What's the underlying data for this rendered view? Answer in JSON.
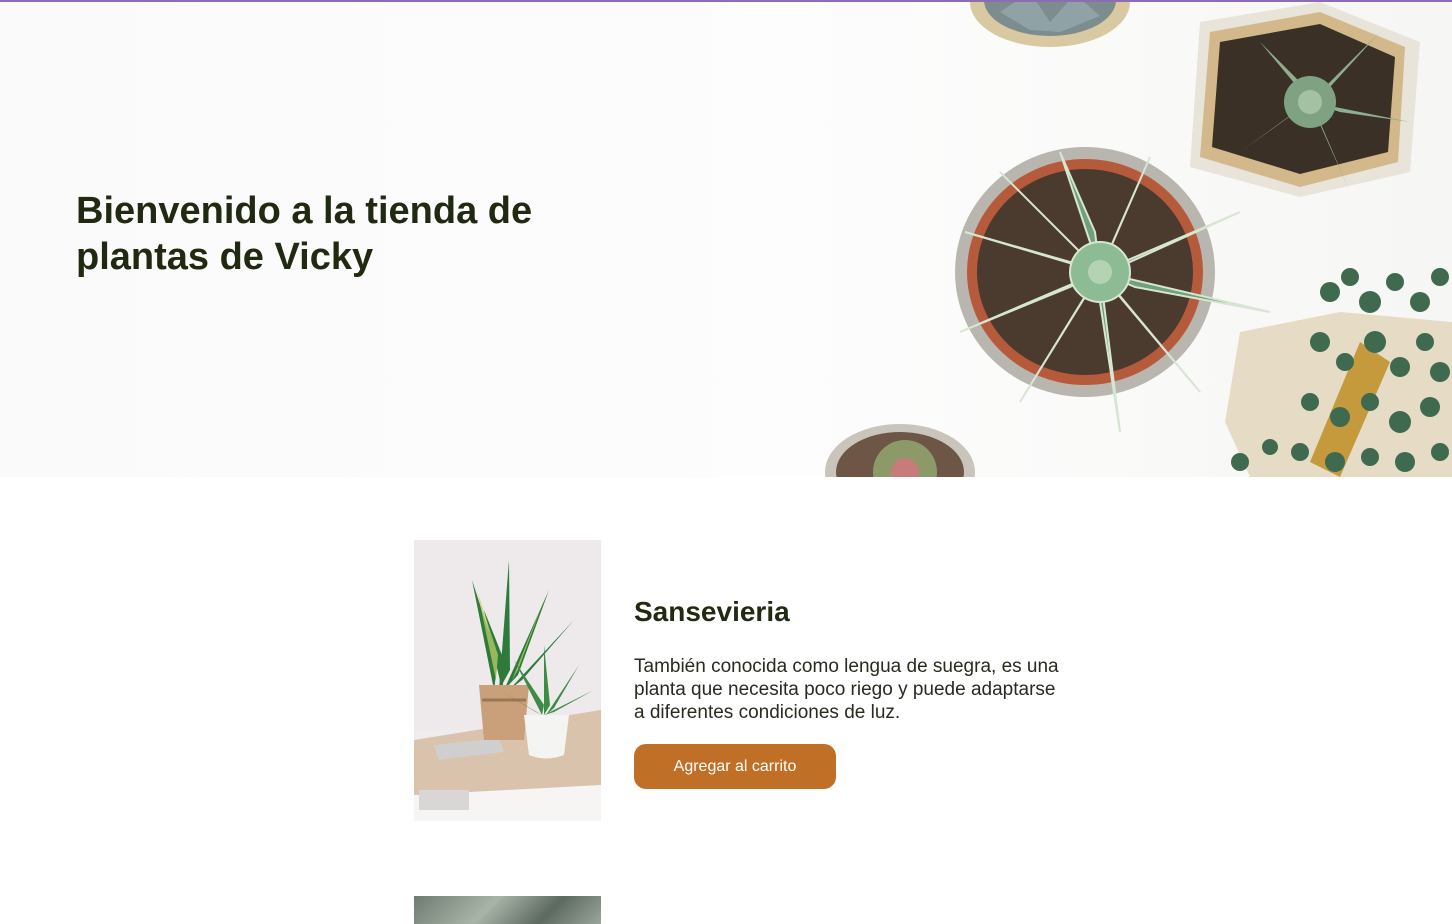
{
  "hero": {
    "title": "Bienvenido a la tienda de plantas de Vicky",
    "image_icon": "succulent-pots-photo"
  },
  "products": [
    {
      "name": "Sansevieria",
      "description": "También conocida como lengua de suegra, es una planta que necesita poco riego y puede adaptarse a diferentes condiciones de luz.",
      "button_label": "Agregar al carrito",
      "image_icon": "snake-plant-photo"
    }
  ],
  "colors": {
    "accent_bar": "#8e6cb5",
    "heading": "#1f2a10",
    "button_bg": "#c07026",
    "button_text": "#ffffff"
  }
}
